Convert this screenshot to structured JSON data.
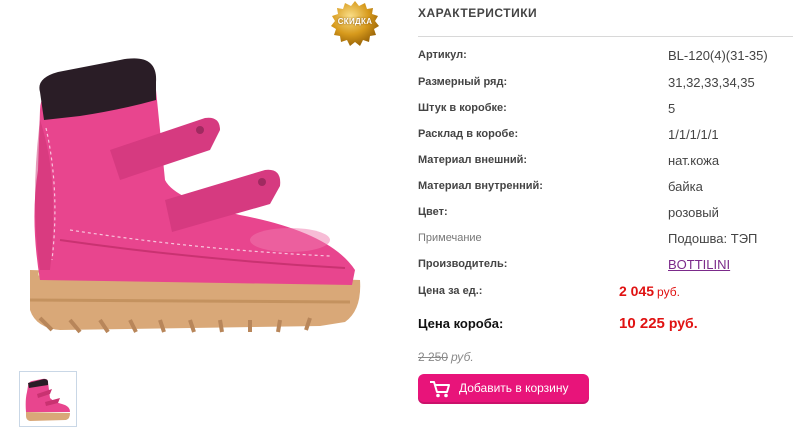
{
  "badge": {
    "label": "СКИДКА"
  },
  "specs": {
    "title": "ХАРАКТЕРИСТИКИ",
    "rows": [
      {
        "label": "Артикул:",
        "value": "BL-120(4)(31-35)"
      },
      {
        "label": "Размерный ряд:",
        "value": "31,32,33,34,35"
      },
      {
        "label": "Штук в коробке:",
        "value": "5"
      },
      {
        "label": "Расклад в коробе:",
        "value": "1/1/1/1/1"
      },
      {
        "label": "Материал внешний:",
        "value": "нат.кожа"
      },
      {
        "label": "Материал внутренний:",
        "value": "байка"
      },
      {
        "label": "Цвет:",
        "value": "розовый"
      },
      {
        "label": "Примечание",
        "value": "Подошва: ТЭП"
      },
      {
        "label": "Производитель:",
        "value": "BOTTILINI"
      }
    ]
  },
  "pricing": {
    "unit_label": "Цена за ед.:",
    "unit_price": "2 045",
    "unit_currency": "руб.",
    "box_label": "Цена короба:",
    "box_price": "10 225",
    "box_currency": "руб.",
    "old_price": "2 250",
    "old_currency": "руб."
  },
  "cart": {
    "label": "Добавить в корзину"
  },
  "colors": {
    "accent_pink": "#e8147a",
    "price_red": "#e01212",
    "boot_pink": "#e8458e",
    "sole_tan": "#d9a878"
  }
}
